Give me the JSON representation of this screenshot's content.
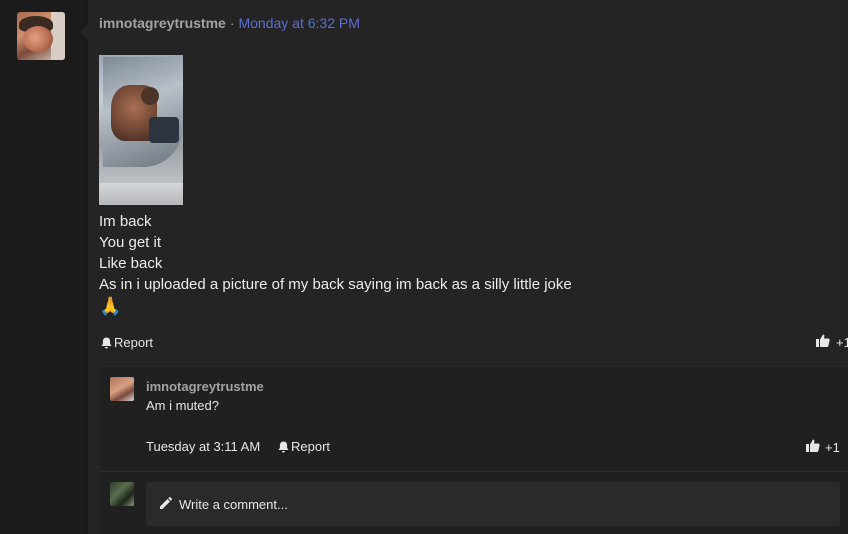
{
  "post": {
    "author": "imnotagreytrustme",
    "separator": "·",
    "timestamp": "Monday at 6:32 PM",
    "lines": [
      "Im back",
      "You get it",
      "Like back",
      "As in i uploaded a picture of my back saying im back as a silly little joke"
    ],
    "emoji": "🙏",
    "report_label": "Report",
    "like_count": "+1"
  },
  "comment": {
    "author": "imnotagreytrustme",
    "text": "Am i muted?",
    "timestamp": "Tuesday at 3:11 AM",
    "report_label": "Report",
    "like_count": "+1"
  },
  "reply": {
    "placeholder": "Write a comment..."
  },
  "colors": {
    "background": "#1b1b1b",
    "post_bg": "#242424",
    "username": "#a3a3a3",
    "timestamp_link": "#5a6fd1",
    "text": "#e6e6e6"
  }
}
